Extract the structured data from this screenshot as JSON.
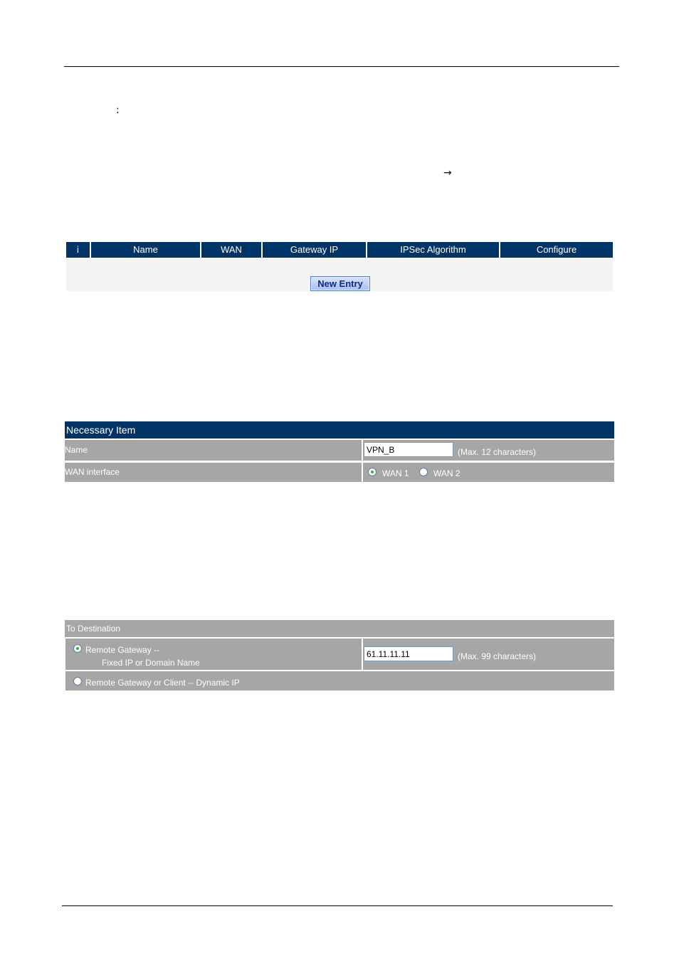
{
  "document": {
    "colon_glyph": ":",
    "arrow_glyph": "→"
  },
  "policy_table": {
    "columns": [
      "i",
      "Name",
      "WAN",
      "Gateway IP",
      "IPSec Algorithm",
      "Configure"
    ],
    "rows": [],
    "new_entry_label": "New Entry"
  },
  "necessary_item": {
    "title": "Necessary Item",
    "name_label": "Name",
    "name_value": "VPN_B",
    "name_hint": "(Max. 12 characters)",
    "wan_label": "WAN interface",
    "wan_options": [
      {
        "label": "WAN 1",
        "checked": true
      },
      {
        "label": "WAN 2",
        "checked": false
      }
    ]
  },
  "to_destination": {
    "title": "To Destination",
    "option1_label": "Remote Gateway --",
    "option1_sublabel": "Fixed IP or Domain Name",
    "option1_checked": true,
    "option1_value": "61.11.11.11",
    "option1_hint": "(Max. 99 characters)",
    "option2_label": "Remote Gateway or Client -- Dynamic IP",
    "option2_checked": false
  },
  "colors": {
    "header_blue": "#003366",
    "row_gray": "#a6a6a6",
    "radio_dot": "#2fae2f"
  }
}
